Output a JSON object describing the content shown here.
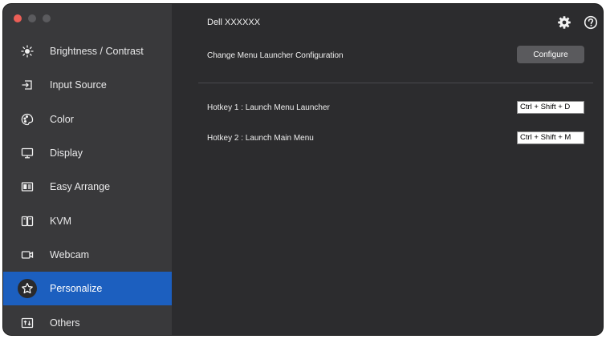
{
  "window": {
    "traffic_lights": [
      "close",
      "minimize",
      "zoom"
    ]
  },
  "sidebar": {
    "items": [
      {
        "label": "Brightness / Contrast",
        "icon": "brightness-icon",
        "active": false
      },
      {
        "label": "Input Source",
        "icon": "input-source-icon",
        "active": false
      },
      {
        "label": "Color",
        "icon": "color-palette-icon",
        "active": false
      },
      {
        "label": "Display",
        "icon": "display-icon",
        "active": false
      },
      {
        "label": "Easy Arrange",
        "icon": "easy-arrange-icon",
        "active": false
      },
      {
        "label": "KVM",
        "icon": "kvm-icon",
        "active": false
      },
      {
        "label": "Webcam",
        "icon": "webcam-icon",
        "active": false
      },
      {
        "label": "Personalize",
        "icon": "star-icon",
        "active": true
      },
      {
        "label": "Others",
        "icon": "others-icon",
        "active": false
      }
    ]
  },
  "header": {
    "monitor_name": "Dell XXXXXX",
    "settings_icon": "gear-icon",
    "help_icon": "help-icon"
  },
  "personalize": {
    "launcher_label": "Change Menu Launcher Configuration",
    "configure_button": "Configure",
    "hotkeys": [
      {
        "label": "Hotkey 1 : Launch Menu Launcher",
        "value": "Ctrl + Shift + D"
      },
      {
        "label": "Hotkey 2 : Launch Main Menu",
        "value": "Ctrl + Shift + M"
      }
    ]
  },
  "colors": {
    "sidebar_bg": "#39393b",
    "main_bg": "#2c2c2e",
    "accent": "#1c5fbf",
    "button_bg": "#5a5a5d"
  }
}
